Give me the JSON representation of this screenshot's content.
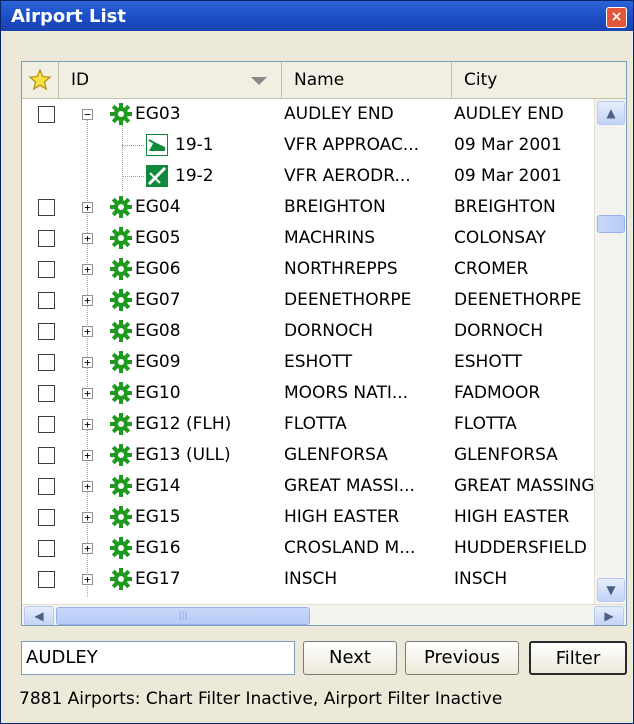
{
  "window": {
    "title": "Airport List",
    "close_label": "×"
  },
  "columns": {
    "star_icon": "star-icon",
    "id": "ID",
    "name": "Name",
    "city": "City"
  },
  "rows": [
    {
      "type": "airport",
      "id": "EG03",
      "name": "AUDLEY END",
      "city": "AUDLEY END",
      "expanded": true
    },
    {
      "type": "chart",
      "id": "19-1",
      "name": "VFR APPROAC...",
      "city": "09 Mar 2001",
      "icon": "approach-chart-icon"
    },
    {
      "type": "chart",
      "id": "19-2",
      "name": "VFR AERODR...",
      "city": "09 Mar 2001",
      "icon": "aerodrome-chart-icon"
    },
    {
      "type": "airport",
      "id": "EG04",
      "name": "BREIGHTON",
      "city": "BREIGHTON"
    },
    {
      "type": "airport",
      "id": "EG05",
      "name": "MACHRINS",
      "city": "COLONSAY"
    },
    {
      "type": "airport",
      "id": "EG06",
      "name": "NORTHREPPS",
      "city": "CROMER"
    },
    {
      "type": "airport",
      "id": "EG07",
      "name": "DEENETHORPE",
      "city": "DEENETHORPE"
    },
    {
      "type": "airport",
      "id": "EG08",
      "name": "DORNOCH",
      "city": "DORNOCH"
    },
    {
      "type": "airport",
      "id": "EG09",
      "name": "ESHOTT",
      "city": "ESHOTT"
    },
    {
      "type": "airport",
      "id": "EG10",
      "name": "MOORS NATI...",
      "city": "FADMOOR"
    },
    {
      "type": "airport",
      "id": "EG12 (FLH)",
      "name": "FLOTTA",
      "city": "FLOTTA"
    },
    {
      "type": "airport",
      "id": "EG13 (ULL)",
      "name": "GLENFORSA",
      "city": "GLENFORSA"
    },
    {
      "type": "airport",
      "id": "EG14",
      "name": "GREAT MASSI...",
      "city": "GREAT MASSING"
    },
    {
      "type": "airport",
      "id": "EG15",
      "name": "HIGH EASTER",
      "city": "HIGH EASTER"
    },
    {
      "type": "airport",
      "id": "EG16",
      "name": "CROSLAND M...",
      "city": "HUDDERSFIELD"
    },
    {
      "type": "airport",
      "id": "EG17",
      "name": "INSCH",
      "city": "INSCH"
    }
  ],
  "search": {
    "value": "AUDLEY"
  },
  "buttons": {
    "next": "Next",
    "previous": "Previous",
    "filter": "Filter"
  },
  "status": "7881 Airports: Chart Filter Inactive, Airport Filter Inactive",
  "colors": {
    "title_bar": "#1b4bc2",
    "airport_icon": "#1e9a1e",
    "chart_icon": "#0f8a3c"
  }
}
